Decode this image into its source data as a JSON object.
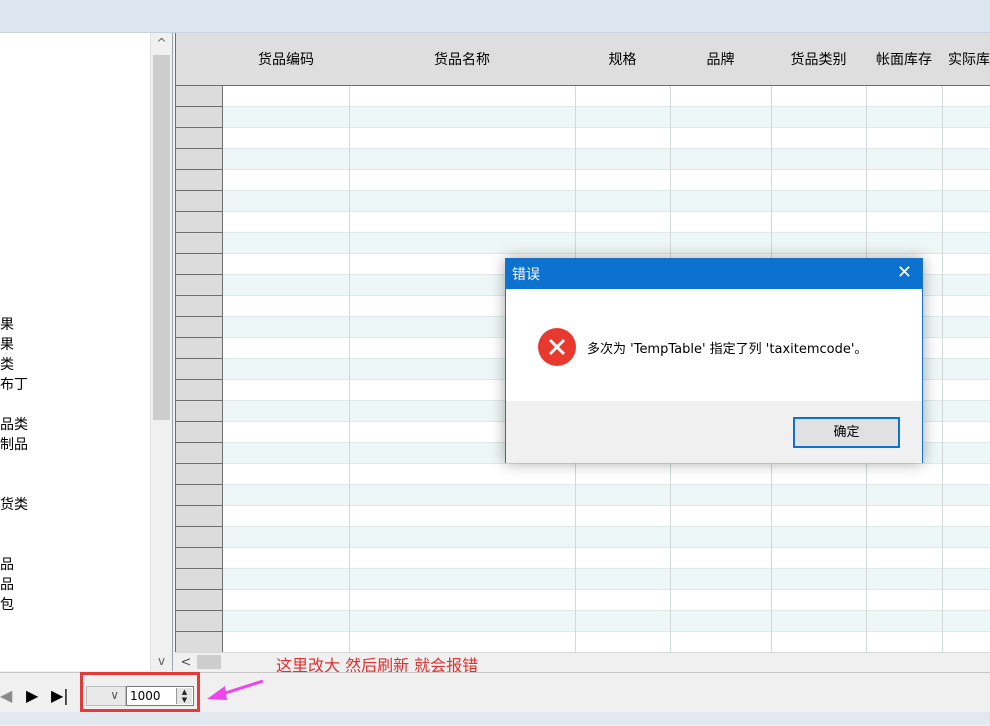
{
  "tree": {
    "items": [
      "果",
      "果",
      "类",
      "布丁",
      "品类",
      "制品",
      "货类",
      "品",
      "品",
      "包"
    ]
  },
  "grid": {
    "columns": [
      "货品编码",
      "货品名称",
      "规格",
      "品牌",
      "货品类别",
      "帐面库存",
      "实际库"
    ]
  },
  "annotation": {
    "note": "这里改大   然后刷新 就会报错"
  },
  "navigator": {
    "prev_icon": "triangle-left-icon",
    "next_icon": "triangle-right-icon",
    "last_icon": "skip-last-icon",
    "page_size_value": "1000"
  },
  "dialog": {
    "title": "错误",
    "message": "多次为 'TempTable' 指定了列 'taxitemcode'。",
    "ok_label": "确定",
    "close_icon": "close-icon",
    "icon": "error-icon"
  },
  "colors": {
    "dialog_title_bg": "#0b72d0",
    "error_red": "#e8392e",
    "annotation_red": "#e03030",
    "arrow_magenta": "#ee44ee",
    "grid_row_tint": "#eef7f7"
  }
}
